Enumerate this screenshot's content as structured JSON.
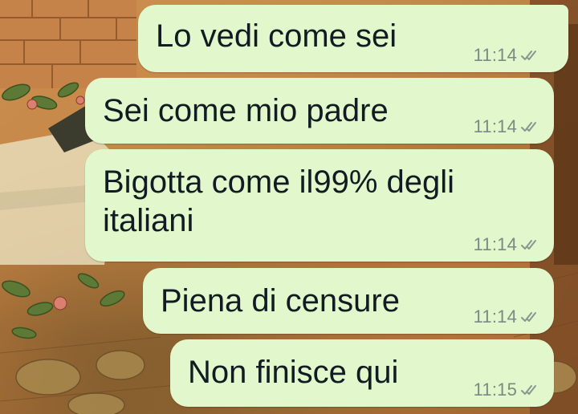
{
  "chat": {
    "bubble_color": "#e2f7cb",
    "text_color": "#111b21",
    "meta_color": "#7d8a84",
    "status_icon": "double-check-icon",
    "messages": [
      {
        "text": "Lo vedi come sei",
        "time": "11:14"
      },
      {
        "text": "Sei come mio padre",
        "time": "11:14"
      },
      {
        "text_line1": "Bigotta come il99% degli",
        "text_line2": "italiani",
        "time": "11:14"
      },
      {
        "text": "Piena di censure",
        "time": "11:14"
      },
      {
        "text": "Non finisce qui",
        "time": "11:15"
      }
    ]
  }
}
